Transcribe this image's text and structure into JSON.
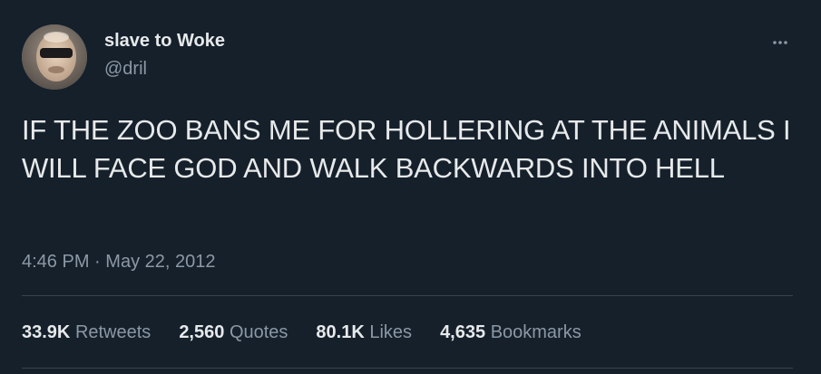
{
  "author": {
    "display_name": "slave to Woke",
    "handle": "@dril"
  },
  "tweet": {
    "text": "IF THE ZOO BANS ME FOR HOLLERING AT THE ANIMALS I WILL FACE GOD AND WALK BACKWARDS INTO HELL",
    "time": "4:46 PM",
    "separator": "·",
    "date": "May 22, 2012"
  },
  "stats": [
    {
      "count": "33.9K",
      "label": "Retweets"
    },
    {
      "count": "2,560",
      "label": "Quotes"
    },
    {
      "count": "80.1K",
      "label": "Likes"
    },
    {
      "count": "4,635",
      "label": "Bookmarks"
    }
  ],
  "icons": {
    "more": "more-horizontal-icon"
  },
  "colors": {
    "background": "#15202b",
    "primary_text": "#e7e9ea",
    "secondary_text": "#8b98a5",
    "divider": "#38444d"
  }
}
